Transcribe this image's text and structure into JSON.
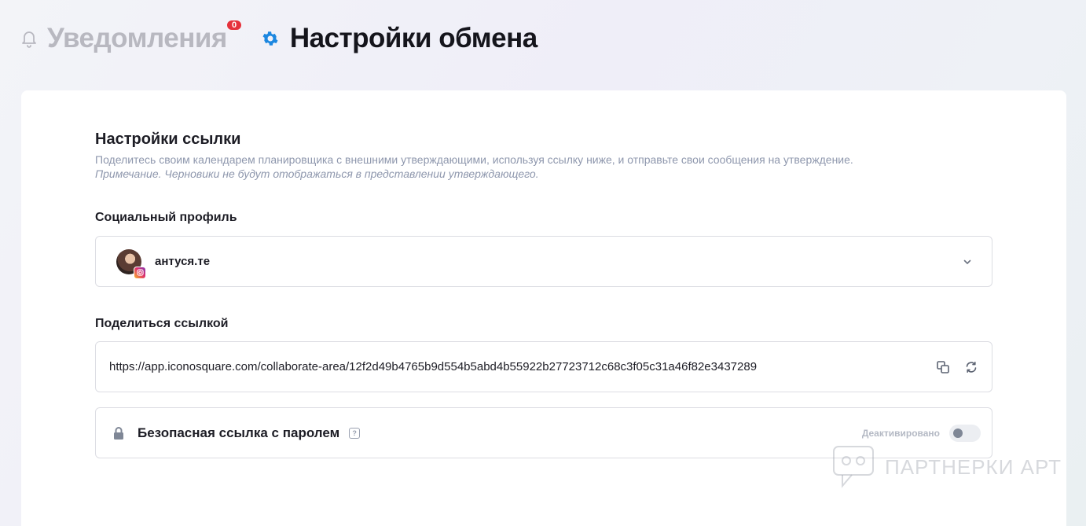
{
  "tabs": {
    "notifications": {
      "label": "Уведомления",
      "badge": "0",
      "icon": "bell-icon"
    },
    "settings": {
      "label": "Настройки обмена",
      "icon": "gear-icon",
      "active": true
    }
  },
  "link_settings": {
    "title": "Настройки ссылки",
    "description": "Поделитесь своим календарем планировщика с внешними утверждающими, используя ссылку ниже, и отправьте свои сообщения на утверждение.",
    "note": "Примечание. Черновики не будут отображаться в представлении утверждающего."
  },
  "social_profile": {
    "label": "Социальный профиль",
    "selected": "антуся.те",
    "network": "instagram"
  },
  "share_link": {
    "label": "Поделиться ссылкой",
    "url": "https://app.iconosquare.com/collaborate-area/12f2d49b4765b9d554b5abd4b55922b27723712c68c3f05c31a46f82e3437289"
  },
  "password": {
    "label": "Безопасная ссылка с паролем",
    "help": "?",
    "status": "Деактивировано",
    "enabled": false
  },
  "watermark": {
    "text": "ПАРТНЕРКИ АРТ"
  },
  "colors": {
    "accent": "#1c87e0",
    "badge": "#e5323c",
    "muted": "#8e97ad"
  }
}
